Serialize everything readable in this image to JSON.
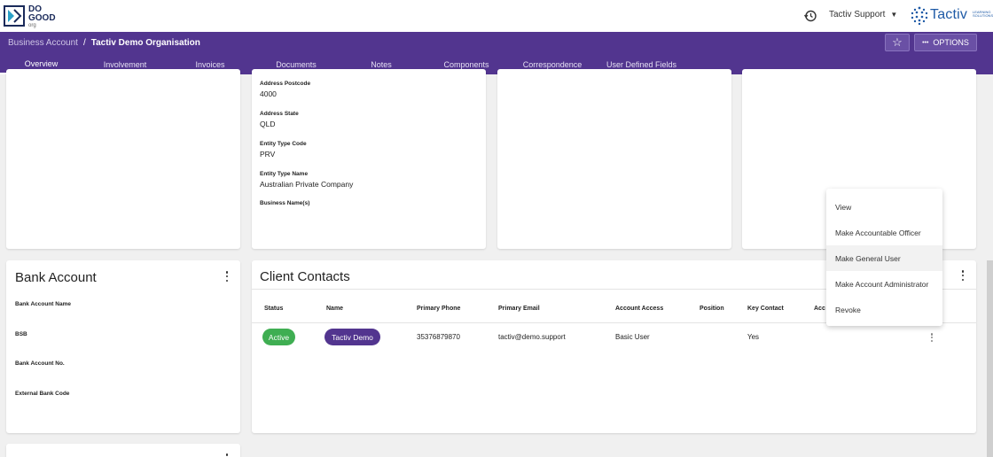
{
  "brand": {
    "logo_line1": "DO",
    "logo_line2": "GOOD",
    "logo_line3": "org",
    "tactiv_word": "Tactiv",
    "tactiv_tagline": "LEARNING SOLUTIONS",
    "accent": "#52358f"
  },
  "topbar": {
    "user_name": "Tactiv Support"
  },
  "breadcrumb": {
    "parent": "Business Account",
    "separator": "/",
    "current": "Tactiv Demo Organisation"
  },
  "header_actions": {
    "star_glyph": "☆",
    "options_glyph": "•••",
    "options_label": "OPTIONS"
  },
  "tabs": [
    {
      "label": "Overview",
      "active": true
    },
    {
      "label": "Involvement"
    },
    {
      "label": "Invoices"
    },
    {
      "label": "Documents"
    },
    {
      "label": "Notes"
    },
    {
      "label": "Components"
    },
    {
      "label": "Correspondence"
    },
    {
      "label": "User Defined Fields"
    }
  ],
  "details_card": {
    "fields": [
      {
        "label": "Address Postcode",
        "value": "4000"
      },
      {
        "label": "Address State",
        "value": "QLD"
      },
      {
        "label": "Entity Type Code",
        "value": "PRV"
      },
      {
        "label": "Entity Type Name",
        "value": "Australian Private Company"
      },
      {
        "label": "Business Name(s)",
        "value": ""
      }
    ]
  },
  "bank_account": {
    "title": "Bank Account",
    "fields": [
      {
        "label": "Bank Account Name"
      },
      {
        "label": "BSB"
      },
      {
        "label": "Bank Account No."
      },
      {
        "label": "External Bank Code"
      }
    ]
  },
  "client_contacts": {
    "title": "Client Contacts",
    "columns": [
      "Status",
      "Name",
      "Primary Phone",
      "Primary Email",
      "Account Access",
      "Position",
      "Key Contact",
      "Acc"
    ],
    "rows": [
      {
        "status": "Active",
        "name": "Tactiv Demo",
        "phone": "35376879870",
        "email": "tactiv@demo.support",
        "account_access": "Basic User",
        "position": "",
        "key_contact": "Yes"
      }
    ],
    "status_color": "#3fae52"
  },
  "context_menu": {
    "items": [
      "View",
      "Make Accountable Officer",
      "Make General User",
      "Make Account Administrator",
      "Revoke"
    ],
    "hovered": "Make General User"
  }
}
